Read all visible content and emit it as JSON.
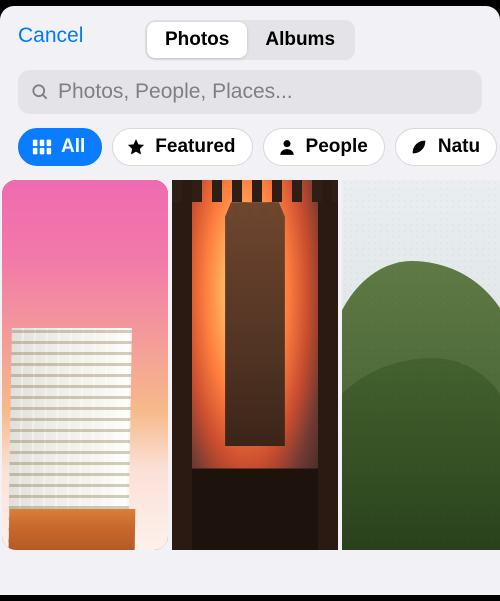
{
  "header": {
    "cancel_label": "Cancel",
    "segments": {
      "photos": "Photos",
      "albums": "Albums"
    },
    "active_segment": "photos"
  },
  "search": {
    "placeholder": "Photos, People, Places..."
  },
  "filters": [
    {
      "key": "all",
      "label": "All",
      "icon": "grid-icon",
      "active": true
    },
    {
      "key": "featured",
      "label": "Featured",
      "icon": "star-icon",
      "active": false
    },
    {
      "key": "people",
      "label": "People",
      "icon": "person-icon",
      "active": false
    },
    {
      "key": "nature",
      "label": "Natu",
      "icon": "leaf-icon",
      "active": false
    }
  ],
  "thumbnails": [
    {
      "name": "photo-1",
      "selected": true
    },
    {
      "name": "photo-2",
      "selected": false
    },
    {
      "name": "photo-3",
      "selected": false
    }
  ],
  "colors": {
    "accent": "#007aff",
    "selection_ring": "#ff3026"
  }
}
